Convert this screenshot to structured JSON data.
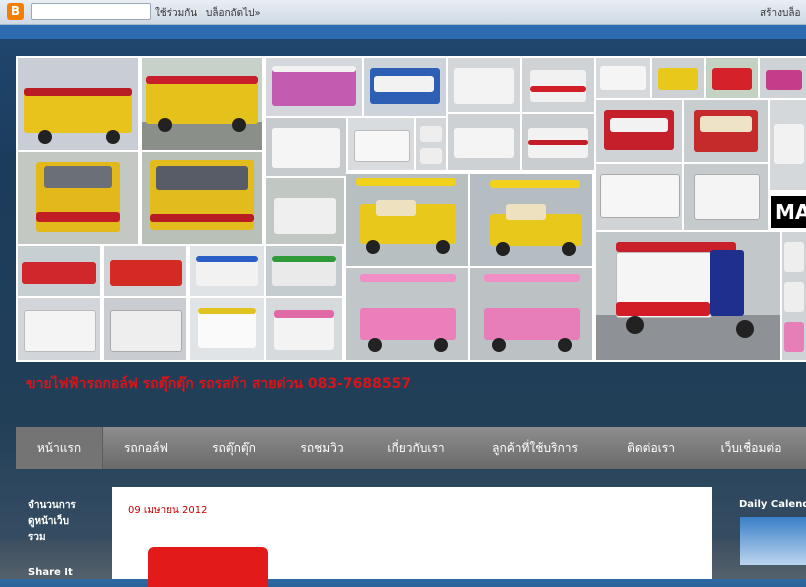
{
  "navbar": {
    "logo_letter": "B",
    "search_value": "",
    "share_label": "ใช้ร่วมกัน",
    "next_blog_label": "บล็อกถัดไป»",
    "create_blog_label": "สร้างบล็อ"
  },
  "header": {
    "brand_logo_text": "MA",
    "sale_text": "ขายไฟฟ้ารถกอล์ฟ รถตุ๊กตุ๊ก รถรสก้า สายด่วน 083-7688557"
  },
  "menu": {
    "items": [
      {
        "label": "หน้าแรก"
      },
      {
        "label": "รถกอล์ฟ"
      },
      {
        "label": "รถตุ๊กตุ๊ก"
      },
      {
        "label": "รถชมวิว"
      },
      {
        "label": "เกี่ยวกับเรา"
      },
      {
        "label": "ลูกค้าที่ใช้บริการ"
      },
      {
        "label": "ติดต่อเรา"
      },
      {
        "label": "เว็บเชื่อมต่อ"
      }
    ]
  },
  "sidebar_left": {
    "visitors_title": "จำนวนการ\nดูหน้าเว็บ\nรวม",
    "share_title": "Share It"
  },
  "post": {
    "date": "09 เมษายน 2012"
  },
  "sidebar_right": {
    "calendar_title": "Daily Calendar"
  },
  "colors": {
    "accent_red": "#d8141a",
    "menu_gray": "#7a7a7a",
    "post_date_red": "#cc0000"
  }
}
